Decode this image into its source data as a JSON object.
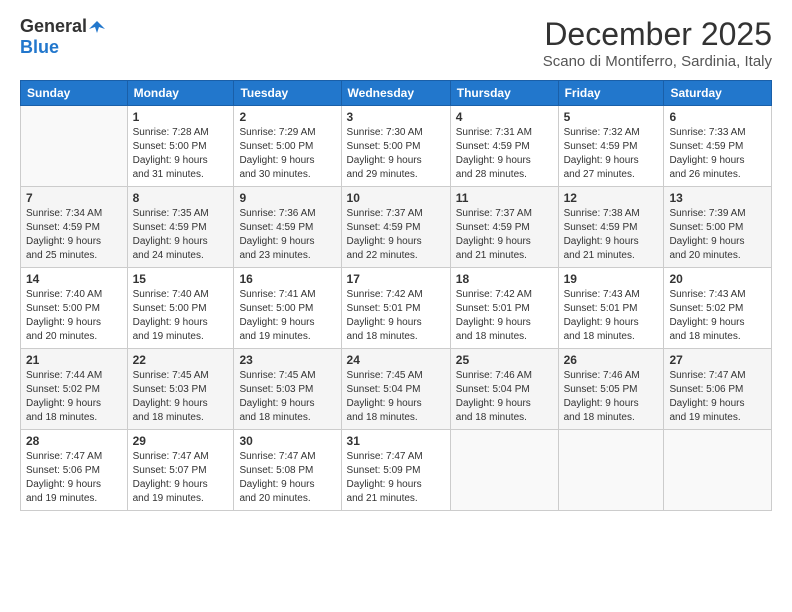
{
  "logo": {
    "line1": "General",
    "line2": "Blue"
  },
  "header": {
    "month": "December 2025",
    "location": "Scano di Montiferro, Sardinia, Italy"
  },
  "weekdays": [
    "Sunday",
    "Monday",
    "Tuesday",
    "Wednesday",
    "Thursday",
    "Friday",
    "Saturday"
  ],
  "weeks": [
    [
      {
        "day": "",
        "info": ""
      },
      {
        "day": "1",
        "info": "Sunrise: 7:28 AM\nSunset: 5:00 PM\nDaylight: 9 hours\nand 31 minutes."
      },
      {
        "day": "2",
        "info": "Sunrise: 7:29 AM\nSunset: 5:00 PM\nDaylight: 9 hours\nand 30 minutes."
      },
      {
        "day": "3",
        "info": "Sunrise: 7:30 AM\nSunset: 5:00 PM\nDaylight: 9 hours\nand 29 minutes."
      },
      {
        "day": "4",
        "info": "Sunrise: 7:31 AM\nSunset: 4:59 PM\nDaylight: 9 hours\nand 28 minutes."
      },
      {
        "day": "5",
        "info": "Sunrise: 7:32 AM\nSunset: 4:59 PM\nDaylight: 9 hours\nand 27 minutes."
      },
      {
        "day": "6",
        "info": "Sunrise: 7:33 AM\nSunset: 4:59 PM\nDaylight: 9 hours\nand 26 minutes."
      }
    ],
    [
      {
        "day": "7",
        "info": "Sunrise: 7:34 AM\nSunset: 4:59 PM\nDaylight: 9 hours\nand 25 minutes."
      },
      {
        "day": "8",
        "info": "Sunrise: 7:35 AM\nSunset: 4:59 PM\nDaylight: 9 hours\nand 24 minutes."
      },
      {
        "day": "9",
        "info": "Sunrise: 7:36 AM\nSunset: 4:59 PM\nDaylight: 9 hours\nand 23 minutes."
      },
      {
        "day": "10",
        "info": "Sunrise: 7:37 AM\nSunset: 4:59 PM\nDaylight: 9 hours\nand 22 minutes."
      },
      {
        "day": "11",
        "info": "Sunrise: 7:37 AM\nSunset: 4:59 PM\nDaylight: 9 hours\nand 21 minutes."
      },
      {
        "day": "12",
        "info": "Sunrise: 7:38 AM\nSunset: 4:59 PM\nDaylight: 9 hours\nand 21 minutes."
      },
      {
        "day": "13",
        "info": "Sunrise: 7:39 AM\nSunset: 5:00 PM\nDaylight: 9 hours\nand 20 minutes."
      }
    ],
    [
      {
        "day": "14",
        "info": "Sunrise: 7:40 AM\nSunset: 5:00 PM\nDaylight: 9 hours\nand 20 minutes."
      },
      {
        "day": "15",
        "info": "Sunrise: 7:40 AM\nSunset: 5:00 PM\nDaylight: 9 hours\nand 19 minutes."
      },
      {
        "day": "16",
        "info": "Sunrise: 7:41 AM\nSunset: 5:00 PM\nDaylight: 9 hours\nand 19 minutes."
      },
      {
        "day": "17",
        "info": "Sunrise: 7:42 AM\nSunset: 5:01 PM\nDaylight: 9 hours\nand 18 minutes."
      },
      {
        "day": "18",
        "info": "Sunrise: 7:42 AM\nSunset: 5:01 PM\nDaylight: 9 hours\nand 18 minutes."
      },
      {
        "day": "19",
        "info": "Sunrise: 7:43 AM\nSunset: 5:01 PM\nDaylight: 9 hours\nand 18 minutes."
      },
      {
        "day": "20",
        "info": "Sunrise: 7:43 AM\nSunset: 5:02 PM\nDaylight: 9 hours\nand 18 minutes."
      }
    ],
    [
      {
        "day": "21",
        "info": "Sunrise: 7:44 AM\nSunset: 5:02 PM\nDaylight: 9 hours\nand 18 minutes."
      },
      {
        "day": "22",
        "info": "Sunrise: 7:45 AM\nSunset: 5:03 PM\nDaylight: 9 hours\nand 18 minutes."
      },
      {
        "day": "23",
        "info": "Sunrise: 7:45 AM\nSunset: 5:03 PM\nDaylight: 9 hours\nand 18 minutes."
      },
      {
        "day": "24",
        "info": "Sunrise: 7:45 AM\nSunset: 5:04 PM\nDaylight: 9 hours\nand 18 minutes."
      },
      {
        "day": "25",
        "info": "Sunrise: 7:46 AM\nSunset: 5:04 PM\nDaylight: 9 hours\nand 18 minutes."
      },
      {
        "day": "26",
        "info": "Sunrise: 7:46 AM\nSunset: 5:05 PM\nDaylight: 9 hours\nand 18 minutes."
      },
      {
        "day": "27",
        "info": "Sunrise: 7:47 AM\nSunset: 5:06 PM\nDaylight: 9 hours\nand 19 minutes."
      }
    ],
    [
      {
        "day": "28",
        "info": "Sunrise: 7:47 AM\nSunset: 5:06 PM\nDaylight: 9 hours\nand 19 minutes."
      },
      {
        "day": "29",
        "info": "Sunrise: 7:47 AM\nSunset: 5:07 PM\nDaylight: 9 hours\nand 19 minutes."
      },
      {
        "day": "30",
        "info": "Sunrise: 7:47 AM\nSunset: 5:08 PM\nDaylight: 9 hours\nand 20 minutes."
      },
      {
        "day": "31",
        "info": "Sunrise: 7:47 AM\nSunset: 5:09 PM\nDaylight: 9 hours\nand 21 minutes."
      },
      {
        "day": "",
        "info": ""
      },
      {
        "day": "",
        "info": ""
      },
      {
        "day": "",
        "info": ""
      }
    ]
  ]
}
